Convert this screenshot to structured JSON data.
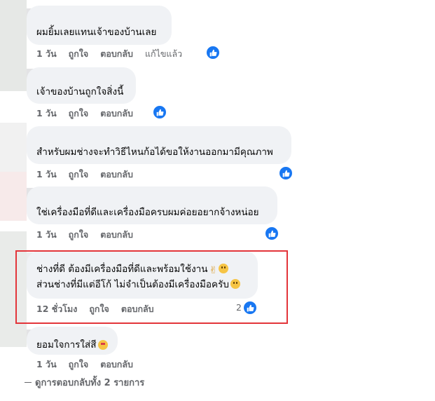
{
  "comments": [
    {
      "text": "ผมยิ้มเลยแทนเจ้าของบ้านเลย",
      "time": "1 วัน",
      "like": "ถูกใจ",
      "reply": "ตอบกลับ",
      "edited": "แก้ไขแล้ว"
    },
    {
      "text": "เจ้าของบ้านถูกใจสิ่งนี้",
      "time": "1 วัน",
      "like": "ถูกใจ",
      "reply": "ตอบกลับ"
    },
    {
      "text": "สำหรับผมช่างจะทำวิธีไหนก้อได้ขอให้งานออกมามีคุณภาพ",
      "time": "1 วัน",
      "like": "ถูกใจ",
      "reply": "ตอบกลับ"
    },
    {
      "text": "ใช่เครื่องมือที่ดีและเครื่องมือครบผมค่อยอยากจ้างหน่อย",
      "time": "1 วัน",
      "like": "ถูกใจ",
      "reply": "ตอบกลับ"
    },
    {
      "line1": "ช่างที่ดี ต้องมีเครื่องมือที่ดีและพร้อมใช้งาน",
      "line2": "ส่วนช่างที่มีแต่อีโก้ ไม่จำเป็นต้องมีเครื่องมือครับ",
      "time": "12 ชั่วโมง",
      "like": "ถูกใจ",
      "reply": "ตอบกลับ",
      "reaction_count": "2"
    },
    {
      "text": "ยอมใจการใส่สี",
      "time": "1 วัน",
      "like": "ถูกใจ",
      "reply": "ตอบกลับ"
    }
  ],
  "view_replies": "ดูการตอบกลับทั้ง 2 รายการ",
  "colors": {
    "bubble": "#f0f2f5",
    "like_blue": "#1877f2",
    "highlight": "#e3353a",
    "meta": "#65676b"
  },
  "icons": {
    "reaction": "like-thumb-icon"
  }
}
